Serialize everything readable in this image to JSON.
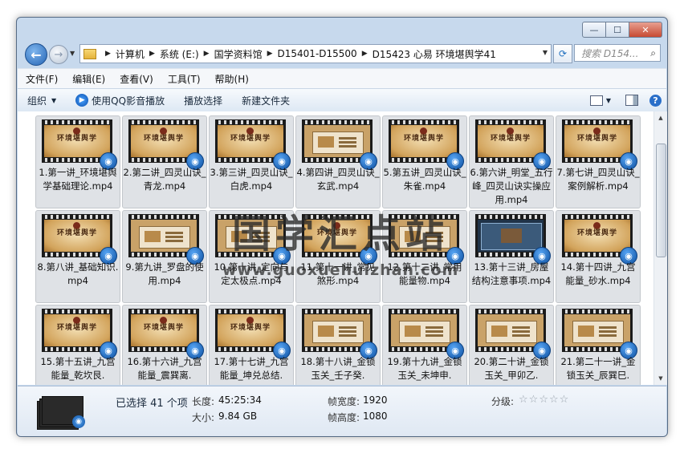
{
  "window": {
    "minimize_glyph": "—",
    "maximize_glyph": "☐",
    "close_glyph": "✕"
  },
  "nav": {
    "breadcrumbs": [
      "计算机",
      "系统 (E:)",
      "国学资料馆",
      "D15401-D15500",
      "D15423 心易 环境堪舆学41"
    ],
    "search_placeholder": "搜索 D154..."
  },
  "menu": [
    "文件(F)",
    "编辑(E)",
    "查看(V)",
    "工具(T)",
    "帮助(H)"
  ],
  "toolbar": {
    "organize": "组织",
    "play_qq": "使用QQ影音播放",
    "play_selected": "播放选择",
    "new_folder": "新建文件夹"
  },
  "thumb_title": "环境堪舆学",
  "files": [
    {
      "name": "1.第一讲_环境堪舆学基础理论.mp4",
      "style": "title"
    },
    {
      "name": "2.第二讲_四灵山诀_青龙.mp4",
      "style": "title"
    },
    {
      "name": "3.第三讲_四灵山诀_白虎.mp4",
      "style": "title"
    },
    {
      "name": "4.第四讲_四灵山诀_玄武.mp4",
      "style": "slide"
    },
    {
      "name": "5.第五讲_四灵山诀_朱雀.mp4",
      "style": "title"
    },
    {
      "name": "6.第六讲_明堂_五行峰_四灵山诀实操应用.mp4",
      "style": "title"
    },
    {
      "name": "7.第七讲_四灵山诀_案例解析.mp4",
      "style": "title"
    },
    {
      "name": "8.第八讲_基础知识.mp4",
      "style": "title"
    },
    {
      "name": "9.第九讲_罗盘的使用.mp4",
      "style": "slide"
    },
    {
      "name": "10.第十讲_定向与定太极点.mp4",
      "style": "slide"
    },
    {
      "name": "11.第十一讲_常见煞形.mp4",
      "style": "title"
    },
    {
      "name": "12.第十二讲_常用能量物.mp4",
      "style": "slide"
    },
    {
      "name": "13.第十三讲_房屋结构注意事项.mp4",
      "style": "dark"
    },
    {
      "name": "14.第十四讲_九宫能量_砂水.mp4",
      "style": "title"
    },
    {
      "name": "15.第十五讲_九宫能量_乾坎艮.",
      "style": "title"
    },
    {
      "name": "16.第十六讲_九宫能量_震巽离.",
      "style": "title"
    },
    {
      "name": "17.第十七讲_九宫能量_坤兑总结.",
      "style": "title"
    },
    {
      "name": "18.第十八讲_金锁玉关_壬子癸.",
      "style": "slide"
    },
    {
      "name": "19.第十九讲_金锁玉关_未坤申.",
      "style": "slide"
    },
    {
      "name": "20.第二十讲_金锁玉关_甲卯乙.",
      "style": "slide"
    },
    {
      "name": "21.第二十一讲_金锁玉关_辰巽巳.",
      "style": "slide"
    }
  ],
  "watermark": {
    "text": "国学汇点站",
    "url": "www.guoxuehuizhan.com"
  },
  "details": {
    "selected": "已选择 41 个项",
    "length_label": "长度:",
    "length_value": "45:25:34",
    "size_label": "大小:",
    "size_value": "9.84 GB",
    "frame_width_label": "帧宽度:",
    "frame_width_value": "1920",
    "frame_height_label": "帧高度:",
    "frame_height_value": "1080",
    "rating_label": "分级:",
    "rating_stars": 0,
    "rating_max": 5
  }
}
